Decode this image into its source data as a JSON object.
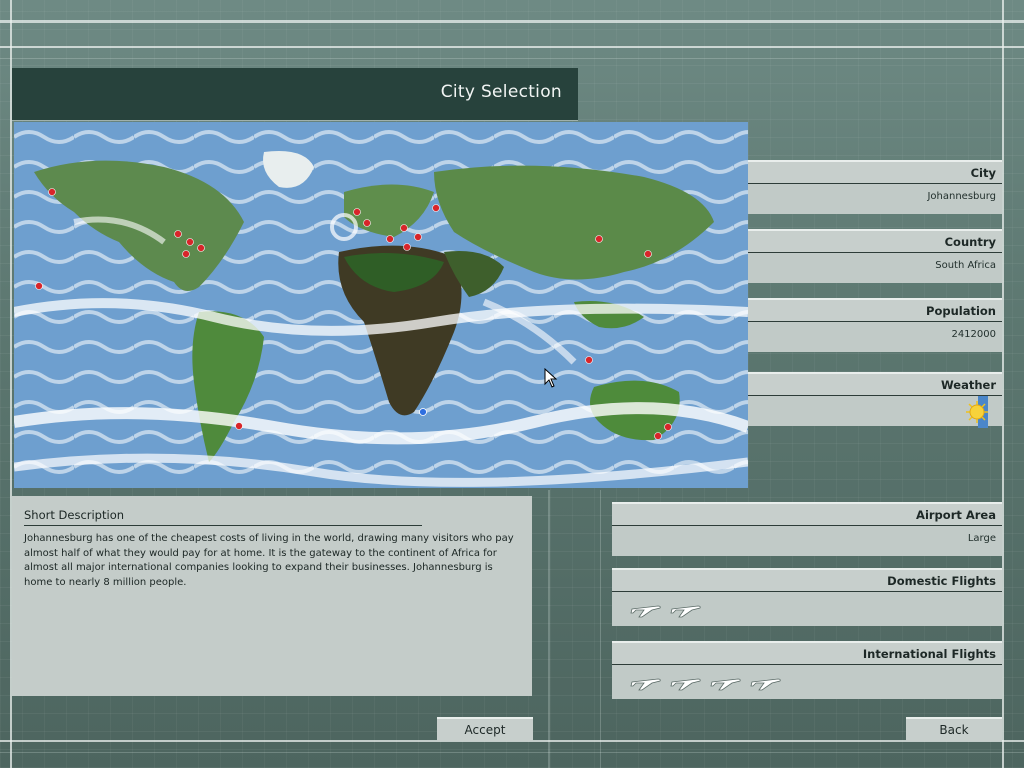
{
  "title": "City Selection",
  "info": {
    "city_label": "City",
    "city_value": "Johannesburg",
    "country_label": "Country",
    "country_value": "South Africa",
    "population_label": "Population",
    "population_value": "2412000",
    "weather_label": "Weather",
    "weather_icon": "sun-icon"
  },
  "description": {
    "title": "Short Description",
    "text": "Johannesburg has one of the cheapest costs of living in the world, drawing many visitors who pay almost half of what they would pay for at home. It is the gateway to the continent of Africa for almost all major international companies looking to expand their businesses. Johannesburg is home to nearly 8 million people."
  },
  "airport": {
    "area_label": "Airport Area",
    "area_value": "Large",
    "domestic_label": "Domestic Flights",
    "domestic_count": 2,
    "international_label": "International Flights",
    "international_count": 4
  },
  "buttons": {
    "accept": "Accept",
    "back": "Back"
  },
  "colors": {
    "title_bar": "#27423c",
    "city_marker": "#d8252a",
    "selected_marker": "#2f6fe0"
  },
  "map": {
    "selected_city": "Johannesburg",
    "marker_count": 22
  }
}
